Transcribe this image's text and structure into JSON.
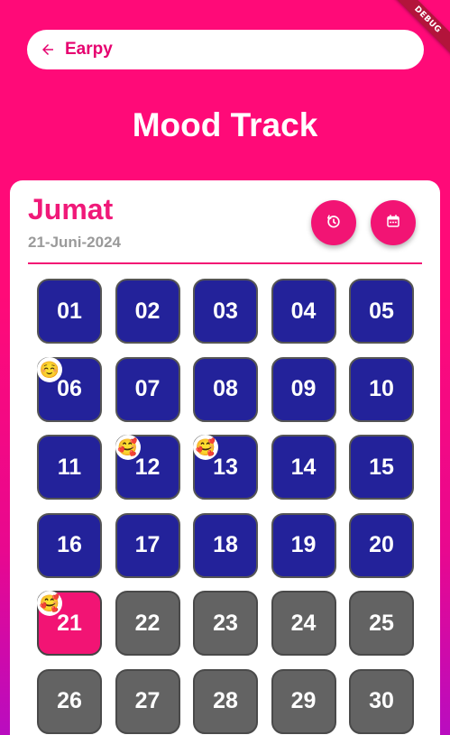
{
  "debug_banner": "DEBUG",
  "header": {
    "back_icon": "arrow-left-icon",
    "app_name": "Earpy"
  },
  "page_title": "Mood Track",
  "card": {
    "day_name": "Jumat",
    "date": "21-Juni-2024",
    "reset_icon": "timer-reset-icon",
    "calendar_icon": "calendar-icon"
  },
  "colors": {
    "background_top": "#ff0a78",
    "background_bottom": "#b90cc0",
    "accent": "#f21474",
    "past_day": "#23229a",
    "future_day": "#636363"
  },
  "days": [
    {
      "label": "01",
      "state": "past",
      "mood": ""
    },
    {
      "label": "02",
      "state": "past",
      "mood": ""
    },
    {
      "label": "03",
      "state": "past",
      "mood": ""
    },
    {
      "label": "04",
      "state": "past",
      "mood": ""
    },
    {
      "label": "05",
      "state": "past",
      "mood": ""
    },
    {
      "label": "06",
      "state": "past",
      "mood": "☺️"
    },
    {
      "label": "07",
      "state": "past",
      "mood": ""
    },
    {
      "label": "08",
      "state": "past",
      "mood": ""
    },
    {
      "label": "09",
      "state": "past",
      "mood": ""
    },
    {
      "label": "10",
      "state": "past",
      "mood": ""
    },
    {
      "label": "11",
      "state": "past",
      "mood": ""
    },
    {
      "label": "12",
      "state": "past",
      "mood": "🥰"
    },
    {
      "label": "13",
      "state": "past",
      "mood": "🥰"
    },
    {
      "label": "14",
      "state": "past",
      "mood": ""
    },
    {
      "label": "15",
      "state": "past",
      "mood": ""
    },
    {
      "label": "16",
      "state": "past",
      "mood": ""
    },
    {
      "label": "17",
      "state": "past",
      "mood": ""
    },
    {
      "label": "18",
      "state": "past",
      "mood": ""
    },
    {
      "label": "19",
      "state": "past",
      "mood": ""
    },
    {
      "label": "20",
      "state": "past",
      "mood": ""
    },
    {
      "label": "21",
      "state": "today",
      "mood": "🥰"
    },
    {
      "label": "22",
      "state": "future",
      "mood": ""
    },
    {
      "label": "23",
      "state": "future",
      "mood": ""
    },
    {
      "label": "24",
      "state": "future",
      "mood": ""
    },
    {
      "label": "25",
      "state": "future",
      "mood": ""
    },
    {
      "label": "26",
      "state": "future",
      "mood": ""
    },
    {
      "label": "27",
      "state": "future",
      "mood": ""
    },
    {
      "label": "28",
      "state": "future",
      "mood": ""
    },
    {
      "label": "29",
      "state": "future",
      "mood": ""
    },
    {
      "label": "30",
      "state": "future",
      "mood": ""
    }
  ]
}
